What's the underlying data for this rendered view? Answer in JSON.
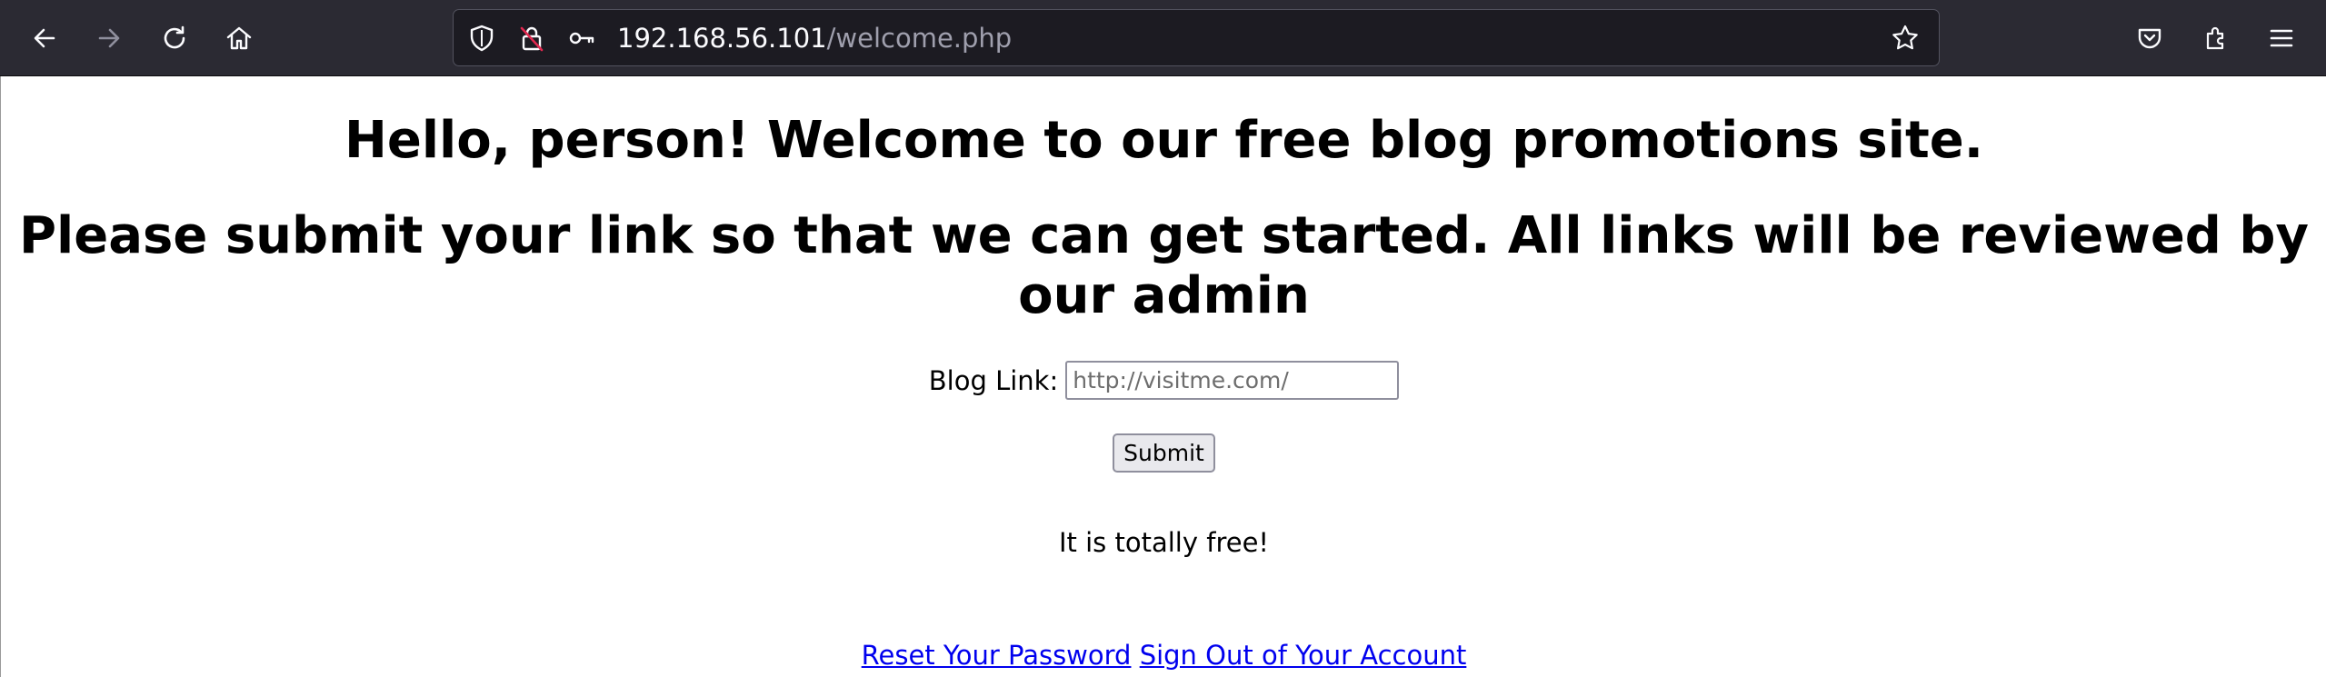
{
  "browser": {
    "url_host": "192.168.56.101",
    "url_path": "/welcome.php",
    "colors": {
      "toolbar_bg": "#2b2a33",
      "urlbar_bg": "#1c1b22",
      "icon": "#fbfbfe",
      "icon_disabled": "#8f8f9d",
      "insecure_accent": "#e22850"
    },
    "icons": {
      "back": "back-arrow-icon",
      "forward": "forward-arrow-icon",
      "reload": "reload-icon",
      "home": "home-icon",
      "tracking_protection": "shield-icon",
      "insecure_lock": "insecure-lock-icon",
      "permissions": "key-icon",
      "bookmark": "star-icon",
      "pocket": "pocket-icon",
      "extensions": "puzzle-icon",
      "menu": "hamburger-menu-icon"
    }
  },
  "page": {
    "heading_1": "Hello, person! Welcome to our free blog promotions site.",
    "heading_2": "Please submit your link so that we can get started. All links will be reviewed by our admin",
    "form": {
      "label": "Blog Link:",
      "input_value": "",
      "input_placeholder": "http://visitme.com/",
      "submit_label": "Submit"
    },
    "free_text": "It is totally free!",
    "links": {
      "reset_password": "Reset Your Password",
      "sign_out": "Sign Out of Your Account"
    },
    "colors": {
      "link": "#0000ee",
      "text": "#000000"
    }
  }
}
